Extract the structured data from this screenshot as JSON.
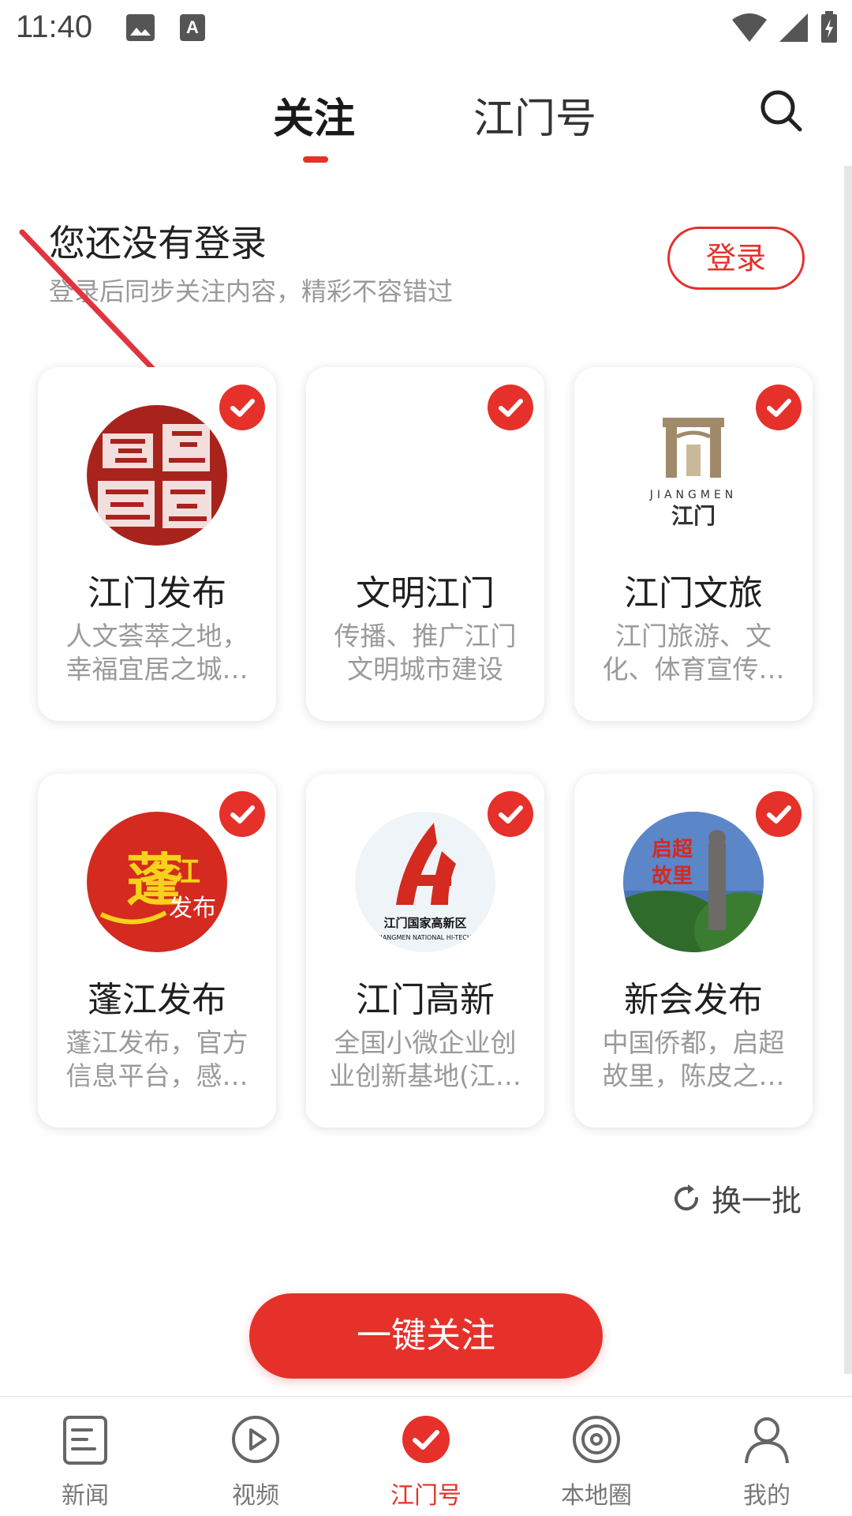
{
  "status_bar": {
    "time": "11:40"
  },
  "top_tabs": [
    {
      "label": "关注",
      "active": true
    },
    {
      "label": "江门号",
      "active": false
    }
  ],
  "login_prompt": {
    "title": "您还没有登录",
    "subtitle": "登录后同步关注内容，精彩不容错过",
    "button": "登录"
  },
  "accounts": [
    {
      "name": "江门发布",
      "desc": "人文荟萃之地，幸福宜居之城…",
      "checked": true,
      "logo": "jiangmen-fabu-logo",
      "logo_text": "侨乡江门"
    },
    {
      "name": "文明江门",
      "desc": "传播、推广江门文明城市建设",
      "checked": true,
      "logo": "blank-logo"
    },
    {
      "name": "江门文旅",
      "desc": "江门旅游、文化、体育宣传…",
      "checked": true,
      "logo": "jiangmen-wenlv-logo",
      "logo_text": "JIANGMEN 江门"
    },
    {
      "name": "蓬江发布",
      "desc": "蓬江发布，官方信息平台，感…",
      "checked": true,
      "logo": "pengjiang-fabu-logo",
      "logo_text": "蓬江发布"
    },
    {
      "name": "江门高新",
      "desc": "全国小微企业创业创新基地(江…",
      "checked": true,
      "logo": "jiangmen-gaoxin-logo",
      "logo_text": "江门国家高新区 JIANGMEN NATIONAL HI-TECH"
    },
    {
      "name": "新会发布",
      "desc": "中国侨都，启超故里，陈皮之…",
      "checked": true,
      "logo": "xinhui-fabu-logo",
      "logo_text": "启超故里"
    }
  ],
  "refresh_label": "换一批",
  "follow_all_label": "一键关注",
  "bottom_nav": [
    {
      "label": "新闻",
      "icon": "news-icon",
      "active": false
    },
    {
      "label": "视频",
      "icon": "video-play-icon",
      "active": false
    },
    {
      "label": "江门号",
      "icon": "jiangmen-check-icon",
      "active": true
    },
    {
      "label": "本地圈",
      "icon": "local-circle-icon",
      "active": false
    },
    {
      "label": "我的",
      "icon": "profile-icon",
      "active": false
    }
  ],
  "colors": {
    "accent": "#e5312a",
    "text": "#222222",
    "muted": "#9a9a9a"
  }
}
